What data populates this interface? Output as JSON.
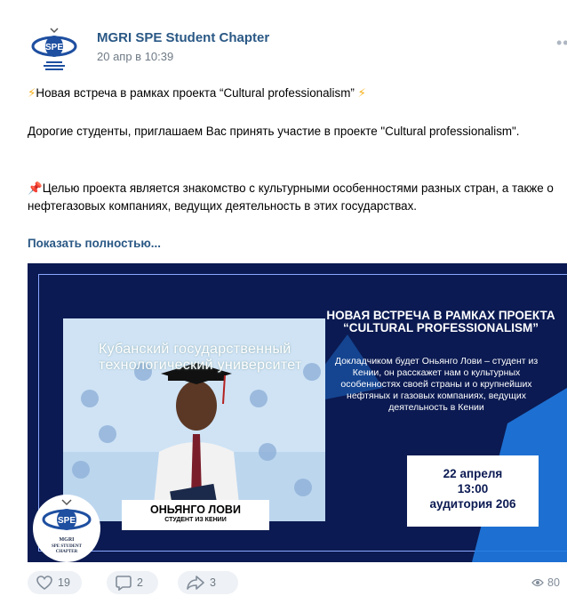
{
  "post": {
    "author": "MGRI SPE Student Chapter",
    "date": "20 апр в 10:39",
    "more_icon": "ellipsis-icon",
    "line1_text": "Новая встреча в рамках проекта “Cultural professionalism”",
    "line2_text": "Дорогие студенты, приглашаем Вас принять участие в проекте \"Cultural professionalism\".",
    "line3_text": "Целью проекта является знакомство с культурными особенностями разных стран, а также о нефтегазовых компаниях, ведущих деятельность в этих государствах.",
    "show_more": "Показать полностью..."
  },
  "banner": {
    "university": "Кубанский государственный технологический университет",
    "title_line1": "НОВАЯ ВСТРЕЧА В РАМКАХ ПРОЕКТА",
    "title_line2": "“CULTURAL PROFESSIONALISM”",
    "description": "Докладчиком будет Оньянго Лови – студент из Кении, он расскажет нам о культурных особенностях своей страны и о крупнейших нефтяных и газовых компаниях, ведущих деятельность в Кении",
    "date_day": "22 апреля",
    "date_time": "13:00",
    "date_room": "аудитория 206",
    "speaker_name": "ОНЬЯНГО ЛОВИ",
    "speaker_sub": "СТУДЕНТ ИЗ КЕНИИ",
    "logo_text_1": "MGRI",
    "logo_text_2": "SPE STUDENT",
    "logo_text_3": "CHAPTER",
    "colors": {
      "navy": "#0b1a52",
      "accent_blue": "#1f7ae0",
      "frame": "#8aa7ff"
    }
  },
  "footer": {
    "likes": "19",
    "comments": "2",
    "shares": "3",
    "views": "80"
  }
}
